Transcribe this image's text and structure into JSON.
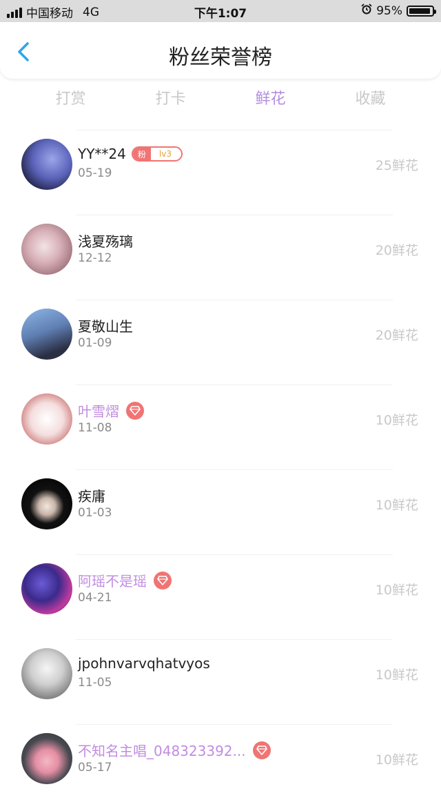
{
  "status_bar": {
    "carrier": "中国移动",
    "network": "4G",
    "time": "下午1:07",
    "battery": "95%"
  },
  "header": {
    "title": "粉丝荣誉榜"
  },
  "tabs": [
    {
      "label": "打赏",
      "active": false
    },
    {
      "label": "打卡",
      "active": false
    },
    {
      "label": "鲜花",
      "active": true
    },
    {
      "label": "收藏",
      "active": false
    }
  ],
  "colors": {
    "accent": "#b48fe0",
    "highlight_name": "#c18ce0",
    "badge_red": "#f07474",
    "back_arrow": "#2aa6ea"
  },
  "fans": [
    {
      "name": "YY**24",
      "date": "05-19",
      "amount": "25鲜花",
      "badge": {
        "fen": "粉",
        "level": "lv3"
      }
    },
    {
      "name": "浅夏殇璃",
      "date": "12-12",
      "amount": "20鲜花"
    },
    {
      "name": "夏敬山生",
      "date": "01-09",
      "amount": "20鲜花"
    },
    {
      "name": "叶雪熠",
      "date": "11-08",
      "amount": "10鲜花",
      "vip": true
    },
    {
      "name": "疾庸",
      "date": "01-03",
      "amount": "10鲜花"
    },
    {
      "name": "阿瑶不是瑶",
      "date": "04-21",
      "amount": "10鲜花",
      "vip": true
    },
    {
      "name": "jpohnvarvqhatvyos",
      "date": "11-05",
      "amount": "10鲜花"
    },
    {
      "name": "不知名主唱_048323392...",
      "date": "05-17",
      "amount": "10鲜花",
      "vip": true
    }
  ]
}
